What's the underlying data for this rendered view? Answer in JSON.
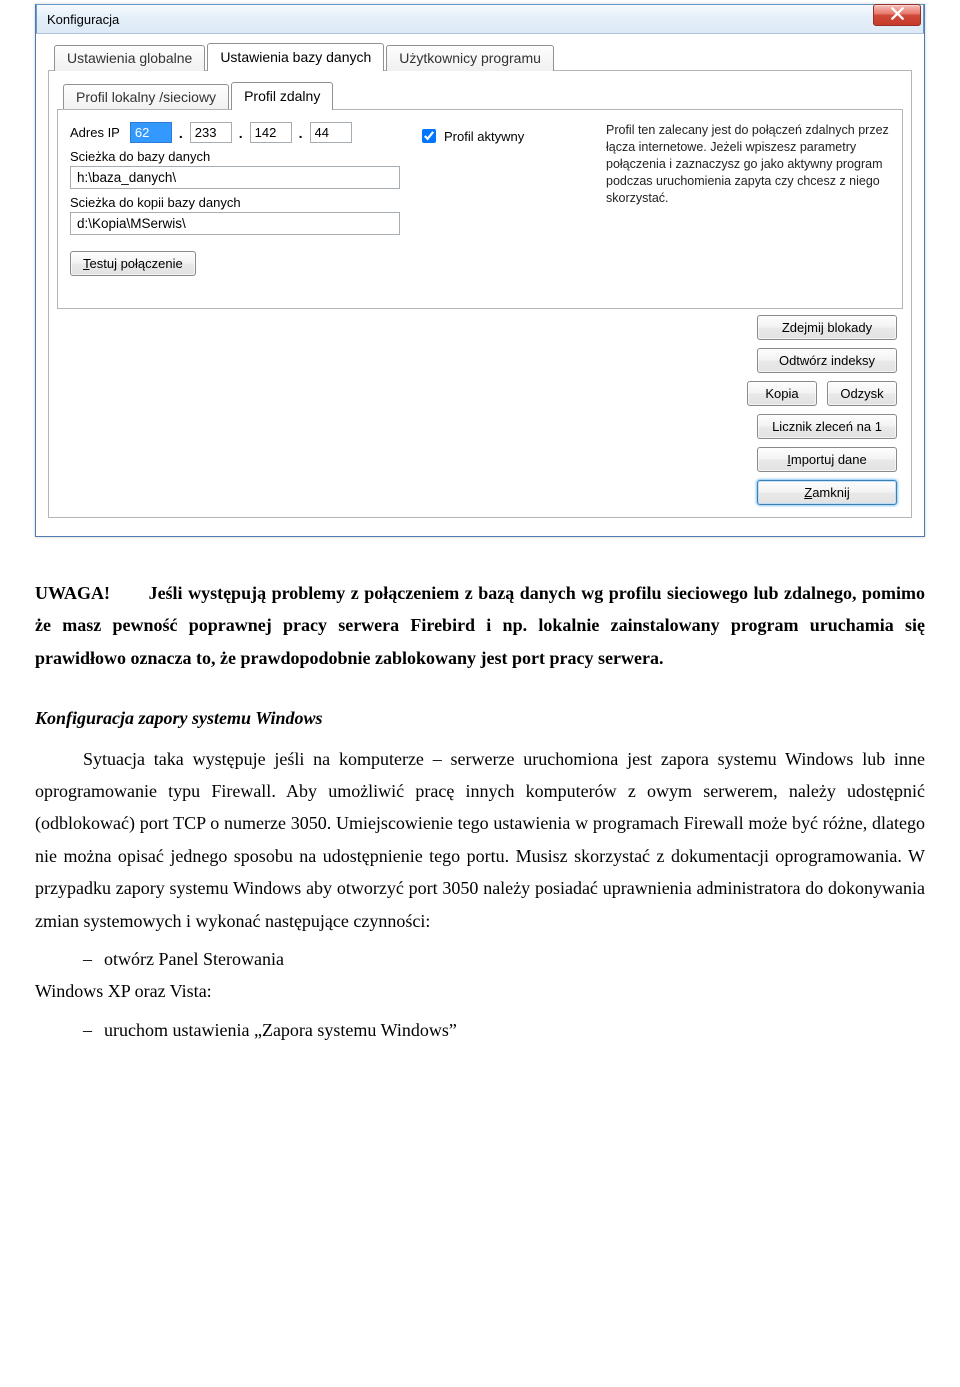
{
  "window": {
    "title": "Konfiguracja"
  },
  "tabs_top": {
    "tab1": "Ustawienia globalne",
    "tab2": "Ustawienia bazy danych",
    "tab3": "Użytkownicy programu"
  },
  "tabs_sub": {
    "tab1": "Profil lokalny /sieciowy",
    "tab2": "Profil zdalny"
  },
  "form": {
    "ip_label": "Adres IP",
    "ip": {
      "o1": "62",
      "o2": "233",
      "o3": "142",
      "o4": "44"
    },
    "db_path_label": "Scieżka do bazy danych",
    "db_path": "h:\\baza_danych\\",
    "db_copy_label": "Scieżka do kopii bazy danych",
    "db_copy": "d:\\Kopia\\MSerwis\\",
    "profile_active_label": "Profil aktywny",
    "help_text": "Profil ten zalecany jest do połączeń zdalnych przez łącza internetowe. Jeżeli wpiszesz parametry połączenia i zaznaczysz go jako aktywny program podczas uruchomienia zapyta czy chcesz z niego skorzystać."
  },
  "buttons": {
    "test_html": "<u class='ak'>T</u>estuj połączenie",
    "unlock": "Zdejmij blokady",
    "rebuild": "Odtwórz indeksy",
    "copy": "Kopia",
    "recover": "Odzysk",
    "counter": "Licznik zleceń na 1",
    "import_html": "<u class='ak'>I</u>mportuj dane",
    "close_html": "<u class='ak'>Z</u>amknij"
  },
  "doc": {
    "warn_label": "UWAGA!",
    "warn_text": "Jeśli występują problemy z połączeniem z bazą danych wg profilu sieciowego lub zdalnego, pomimo że masz pewność poprawnej pracy serwera Firebird i np. lokalnie zainstalowany program uruchamia się prawidłowo oznacza to, że prawdopodobnie zablokowany jest port pracy serwera.",
    "head": "Konfiguracja zapory systemu Windows",
    "body": "Sytuacja taka występuje jeśli na komputerze – serwerze uruchomiona jest zapora systemu Windows lub inne oprogramowanie typu Firewall. Aby umożliwić pracę innych komputerów z owym serwerem, należy udostępnić (odblokować) port TCP o numerze 3050. Umiejscowienie tego ustawienia w programach Firewall może być różne, dlatego nie można opisać jednego sposobu na udostępnienie tego portu. Musisz skorzystać z dokumentacji oprogramowania. W przypadku zapory systemu Windows aby otworzyć port 3050 należy posiadać uprawnienia administratora do dokonywania zmian systemowych i wykonać następujące czynności:",
    "li1": "otwórz Panel Sterowania",
    "os_line": "Windows XP oraz Vista:",
    "li2": "uruchom ustawienia „Zapora systemu Windows”"
  }
}
